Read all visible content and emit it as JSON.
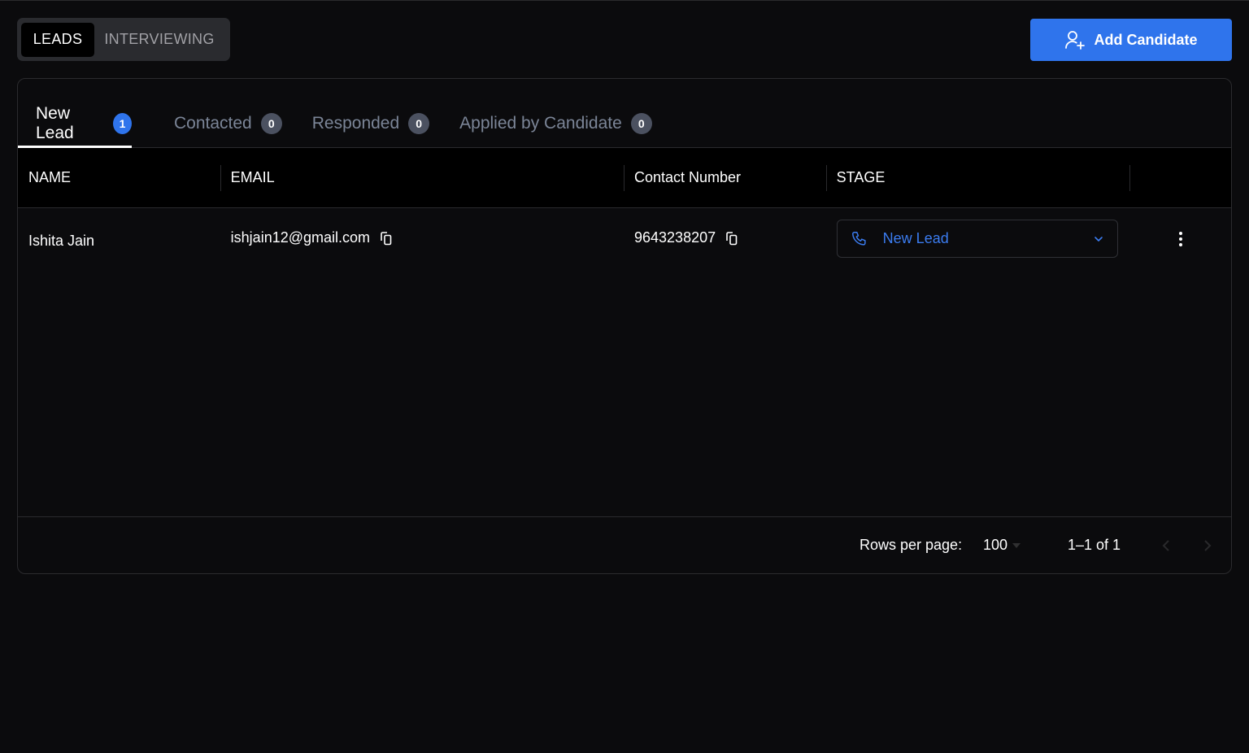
{
  "mode_toggle": {
    "options": [
      {
        "label": "LEADS",
        "active": true
      },
      {
        "label": "INTERVIEWING",
        "active": false
      }
    ]
  },
  "actions": {
    "add_candidate_label": "Add Candidate",
    "add_candidate_icon": "user-plus-icon",
    "accent_color": "#2f74ec"
  },
  "tabs": [
    {
      "label": "New Lead",
      "count": "1",
      "active": true
    },
    {
      "label": "Contacted",
      "count": "0",
      "active": false
    },
    {
      "label": "Responded",
      "count": "0",
      "active": false
    },
    {
      "label": "Applied by Candidate",
      "count": "0",
      "active": false
    }
  ],
  "table": {
    "columns": [
      "NAME",
      "EMAIL",
      "Contact Number",
      "STAGE",
      ""
    ],
    "rows": [
      {
        "name": "Ishita Jain",
        "email": "ishjain12@gmail.com",
        "contact_number": "9643238207",
        "stage": "New Lead",
        "stage_icon": "phone-icon",
        "stage_color": "#3b7cf0"
      }
    ]
  },
  "pagination": {
    "rows_per_page_label": "Rows per page:",
    "rows_per_page_value": "100",
    "range_text": "1–1 of 1"
  }
}
